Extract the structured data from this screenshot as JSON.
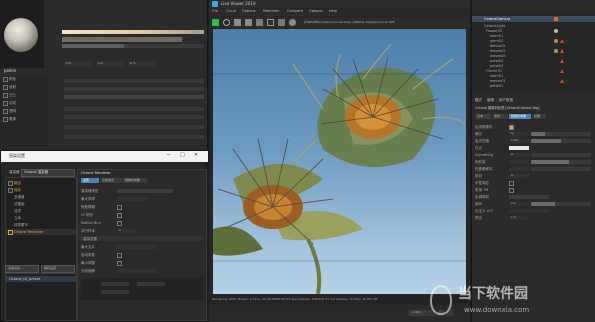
{
  "material_panel": {
    "preset_name": "pollen",
    "rows": [
      "颜色",
      "漫射",
      "凹凸",
      "法线",
      "透明",
      "置换"
    ],
    "field_values": [
      "0.5",
      "1.0",
      "0 %"
    ]
  },
  "dialog": {
    "title": "渲染设置",
    "renderer_label": "渲染器",
    "renderer_value": "Octane 渲染器",
    "list_items": [
      "输出",
      "保存",
      "多通道",
      "抗锯齿",
      "选项",
      "立体",
      "材质覆写",
      "Octane Renderer"
    ],
    "panel_title": "Octane Renderer",
    "tabs": [
      "设置",
      "渲染通道",
      "摄像机成像"
    ],
    "settings": [
      "渲染器类型",
      "最大采样",
      "焦散模糊",
      "GI 修剪",
      "Motion Blur",
      "并行样本",
      "最大瓦片",
      "自动参数",
      "最小调整",
      "光线偏移"
    ],
    "value": "1",
    "section_label": "渲染设置",
    "bottom_button": "渲染设置...",
    "preset_item": "Octane_LV_preset",
    "footer_button": "保存设置"
  },
  "viewport": {
    "title": "Live Viewer 2019",
    "menu": [
      "File",
      "Cloud",
      "Options",
      "Materials",
      "Compare",
      "Options",
      "Help"
    ],
    "info": "[FINISHED] Channel to backup(-) 800ms, background at 798",
    "status": "Rendering 100%  Ms/sec: 0  Time: 00:00:00/00:00:04  Spp/maxspp: 500/128  Tri: 0/4  Meshes: 1k  Hair: 1k  RTX:off",
    "zoom": "1.000"
  },
  "object_manager": {
    "top_item": "OctaneCamera",
    "items": [
      "OctaneLight",
      "Flower02",
      "stem01",
      "stem02",
      "leaves01",
      "leaves02",
      "leaves03",
      "petal01",
      "petal02",
      "Flower01",
      "stem01",
      "leaves01",
      "petal01"
    ]
  },
  "attr_manager": {
    "tabs": [
      "模式",
      "编辑",
      "用户数据"
    ],
    "object_line": "Octane 摄像机标签 [OctaneCamera.Tag]",
    "sub_tabs": [
      "基本",
      "坐标",
      "摄像机成像",
      "后期"
    ],
    "rows": [
      "启用摄像机",
      "曝光",
      "高光压缩",
      "白点",
      "Vignetting",
      "饱和度",
      "热像素移除",
      "剪切",
      "中性响应",
      "禁用 TM",
      "色调映射",
      "伽玛",
      "自定义 LUT",
      "预设"
    ],
    "values": [
      "1.",
      "1.00",
      "0.",
      "0.",
      "2.2",
      "1.2"
    ]
  },
  "watermark": {
    "text1": "当下软件园",
    "text2": "www.downxia.com"
  }
}
